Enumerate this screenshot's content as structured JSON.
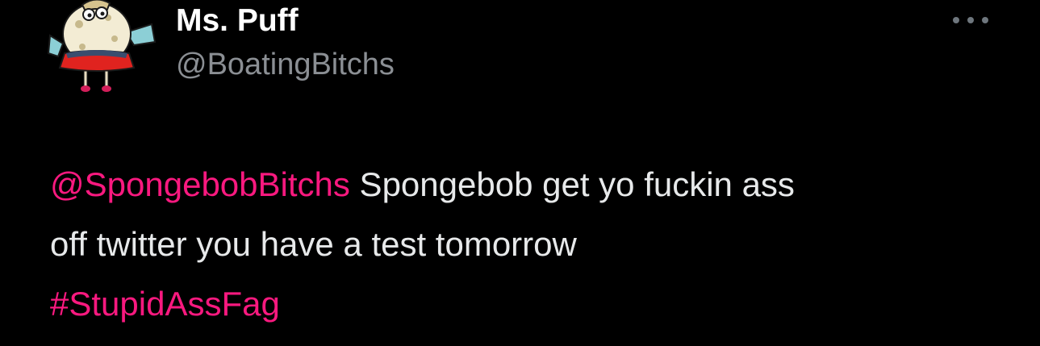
{
  "author": {
    "display_name": "Ms. Puff",
    "handle": "@BoatingBitchs",
    "avatar_icon": "mrs-puff-avatar"
  },
  "menu": {
    "icon": "more-horizontal-icon"
  },
  "tweet": {
    "mention": "@SpongebobBitchs",
    "text_line1": " Spongebob get yo fuckin ass",
    "text_line2": "off twitter you have a test tomorrow",
    "hashtag": "#StupidAssFag"
  },
  "colors": {
    "background": "#000000",
    "link": "#f9197f",
    "text": "#e7e9ea",
    "handle": "#8b8f94"
  }
}
